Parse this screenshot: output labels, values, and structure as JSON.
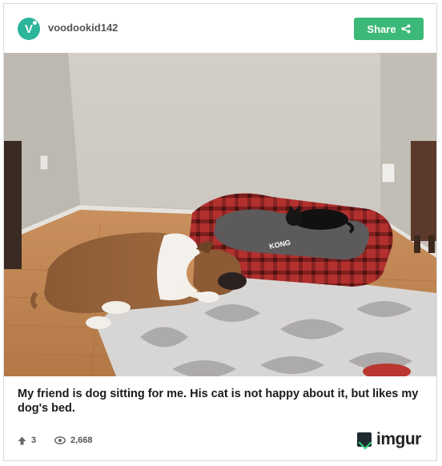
{
  "post": {
    "avatar_letter": "V",
    "username": "voodookid142",
    "share_label": "Share",
    "caption": "My friend is dog sitting for me. His cat is not happy about it, but likes my dog's bed.",
    "image_alt": "Bulldog sleeping on a wooden floor next to a rug while a black cat lies in a red plaid dog bed",
    "bed_brand": "KONG"
  },
  "stats": {
    "upvotes": "3",
    "views": "2,668"
  },
  "brand": {
    "name": "imgur"
  },
  "colors": {
    "accent": "#3cb878",
    "avatar": "#2bb59a"
  },
  "icons": [
    "share-icon",
    "upvote-arrow-icon",
    "eye-icon",
    "imgur-logo-icon"
  ]
}
